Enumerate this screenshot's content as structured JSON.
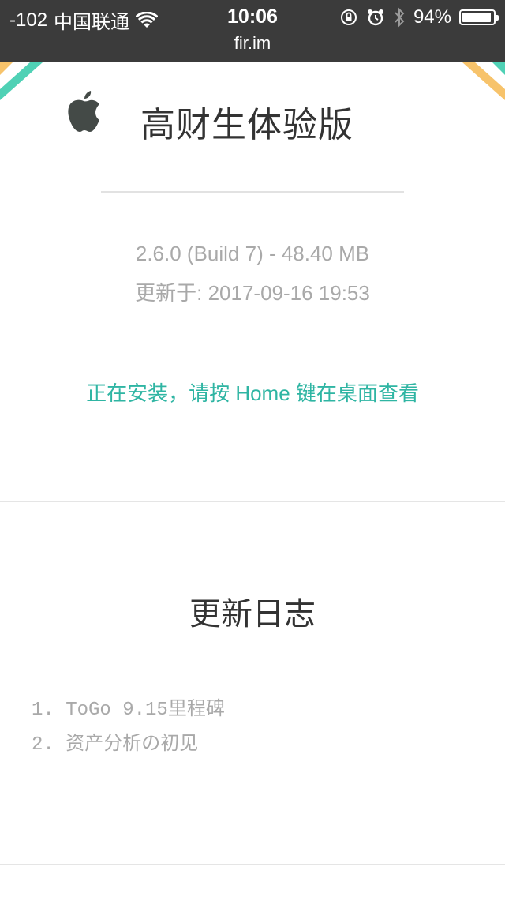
{
  "status_bar": {
    "signal": "-102",
    "carrier": "中国联通",
    "time": "10:06",
    "url": "fir.im",
    "battery": "94%",
    "battery_level": 0.94
  },
  "app": {
    "name": "高财生体验版",
    "platform_icon": "apple-icon",
    "version_info": "2.6.0 (Build 7) - 48.40 MB",
    "updated_at": "更新于: 2017-09-16 19:53",
    "install_message": "正在安装，请按 Home 键在桌面查看"
  },
  "changelog": {
    "title": "更新日志",
    "items": [
      "1. ToGo 9.15里程碑",
      "2. 资产分析の初见"
    ]
  },
  "colors": {
    "accent": "#2fb5a3",
    "ribbon_teal": "#4fd1b5",
    "ribbon_orange": "#f7c36b"
  }
}
